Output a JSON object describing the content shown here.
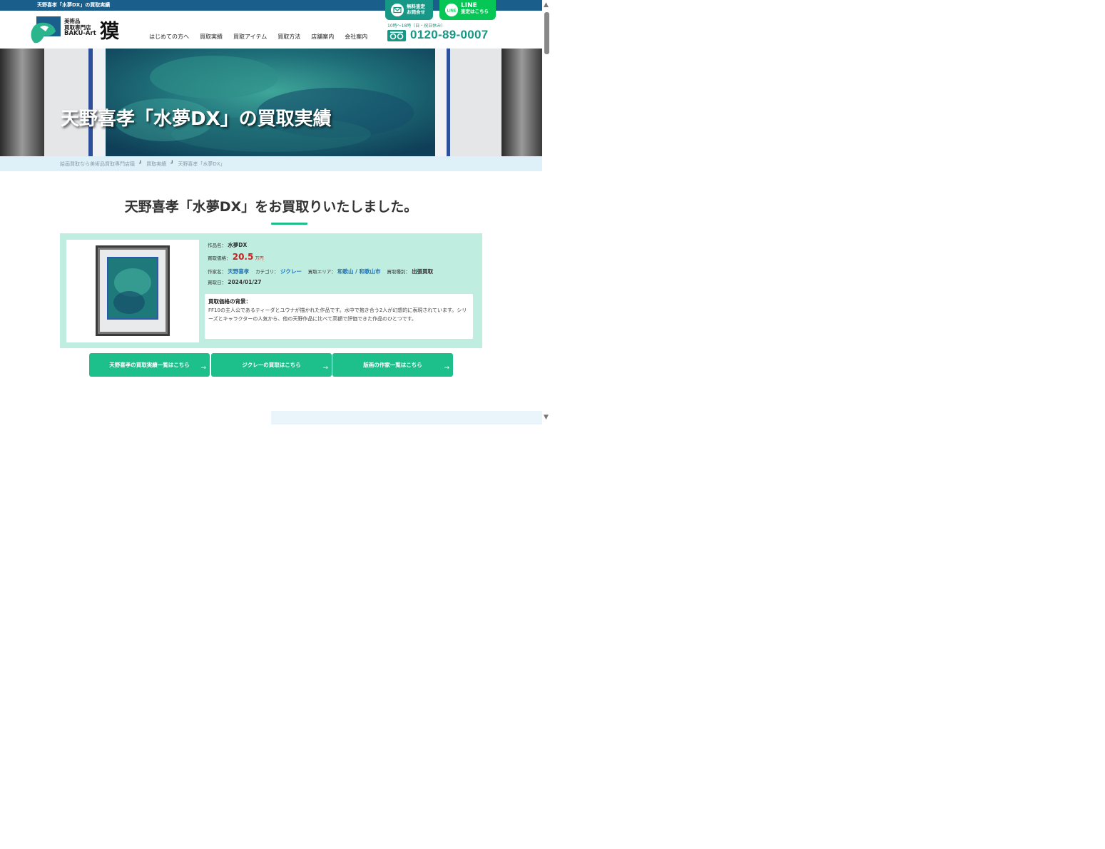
{
  "page_title_bar": "天野喜孝「水夢DX」の買取実績",
  "logo": {
    "line1": "美術品",
    "line2": "買取専門店",
    "line3": "BAKU-Art",
    "kanji": "獏"
  },
  "nav": [
    "はじめての方へ",
    "買取実績",
    "買取アイテム",
    "買取方法",
    "店舗案内",
    "会社案内"
  ],
  "contact": {
    "mail_line1": "無料査定",
    "mail_line2": "お問合せ",
    "line_line1": "LINE",
    "line_line2": "査定はこちら",
    "line_badge": "LINE",
    "hours": "10時～18時（日・祝日休み）",
    "phone": "0120-89-0007"
  },
  "hero": {
    "title": "天野喜孝「水夢DX」の買取実績"
  },
  "breadcrumb": [
    "絵画買取なら美術品買取専門店獏",
    "買取実績",
    "天野喜孝「水夢DX」"
  ],
  "heading": "天野喜孝「水夢DX」をお買取りいたしました。",
  "record": {
    "title_label": "作品名：",
    "title_value": "水夢DX",
    "price_label": "買取価格：",
    "price_value": "20.5",
    "price_unit": "万円",
    "artist_label": "作家名：",
    "artist_value": "天野喜孝",
    "category_label": "カテゴリ：",
    "category_value": "ジクレー",
    "area_label": "買取エリア：",
    "area_value": "和歌山 / 和歌山市",
    "type_label": "買取種別：",
    "type_value": "出張買取",
    "date_label": "買取日：",
    "date_value": "2024/01/27",
    "background_title": "買取価格の背景：",
    "background_text": "FF10の主人公であるティーダとユウナが描かれた作品です。水中で抱き合う2人が幻想的に表現されています。シリーズとキャラクターの人気から、他の天野作品に比べて高額で評価できた作品のひとつです。"
  },
  "cta_buttons": [
    "天野喜孝の買取実績一覧はこちら",
    "ジクレーの買取はこちら",
    "版画の作家一覧はこちら"
  ],
  "colors": {
    "brand_teal": "#179886",
    "accent_green": "#1dbf8a",
    "line_green": "#06c755",
    "topbar_blue": "#1a5e8c",
    "price_red": "#cc1f1f",
    "card_bg": "#bfeee0"
  },
  "icons": [
    "mail-icon",
    "line-icon",
    "free-dial-icon",
    "arrow-right-icon",
    "scroll-up-icon",
    "scroll-down-icon"
  ]
}
